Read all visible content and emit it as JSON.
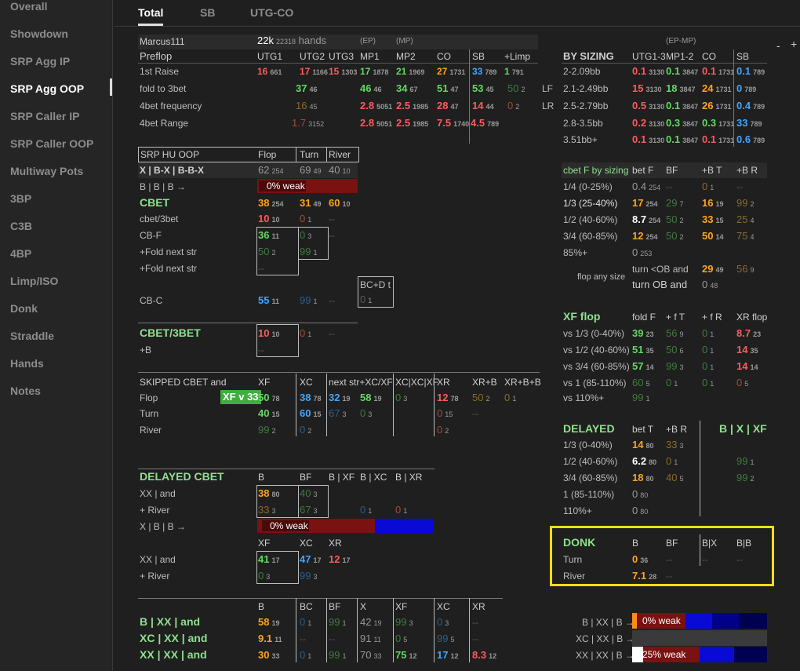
{
  "sidebar": {
    "items": [
      "Overall",
      "Showdown",
      "SRP Agg IP",
      "SRP Agg OOP",
      "SRP Caller IP",
      "SRP Caller OOP",
      "Multiway Pots",
      "3BP",
      "C3B",
      "4BP",
      "Limp/ISO",
      "Donk",
      "Straddle",
      "Hands",
      "Notes"
    ],
    "active": "SRP Agg OOP"
  },
  "tabs": [
    "Total",
    "SB",
    "UTG-CO"
  ],
  "ui": {
    "plus": "+",
    "minus": "-"
  },
  "player": {
    "name": "Marcus111",
    "hands_big": "22k",
    "hands_small": "22318",
    "hands_label": "hands",
    "ep": "(EP)",
    "mp": "(MP)"
  },
  "preflop": {
    "title": "Preflop",
    "cols": [
      "UTG1",
      "UTG2",
      "UTG3",
      "MP1",
      "MP2",
      "CO",
      "SB",
      "+Limp"
    ],
    "rows": [
      {
        "label": "1st Raise",
        "cells": [
          [
            "16",
            "661"
          ],
          [
            "17",
            "1166"
          ],
          [
            "15",
            "1303"
          ],
          [
            "17",
            "1878"
          ],
          [
            "21",
            "1969"
          ],
          [
            "27",
            "1731"
          ],
          [
            "33",
            "789"
          ],
          [
            "1",
            "791"
          ]
        ]
      },
      {
        "label": "fold to 3bet",
        "cells": [
          [
            "37",
            "46"
          ],
          [
            "46",
            "46"
          ],
          [
            "34",
            "67"
          ],
          [
            "51",
            "47"
          ],
          [
            "53",
            "45"
          ],
          [
            "50",
            "2"
          ]
        ],
        "suffix": "LF"
      },
      {
        "label": "4bet frequency",
        "cells": [
          [
            "16",
            "45"
          ],
          [
            "2.8",
            "5051"
          ],
          [
            "2.5",
            "1985"
          ],
          [
            "28",
            "47"
          ],
          [
            "14",
            "44"
          ],
          [
            "0",
            "2"
          ]
        ],
        "suffix": "LR"
      },
      {
        "label": "4bet Range",
        "cells": [
          [
            "1.7",
            "3152"
          ],
          [
            "2.8",
            "5051"
          ],
          [
            "2.5",
            "1985"
          ],
          [
            "7.5",
            "1740"
          ],
          [
            "4.5",
            "789"
          ]
        ]
      }
    ]
  },
  "bysizing": {
    "title": "BY SIZING",
    "epmp": "(EP-MP)",
    "cols": [
      "UTG1-3",
      "MP1-2",
      "CO",
      "SB"
    ],
    "rows": [
      {
        "label": "2-2.09bb",
        "cells": [
          [
            "0.1",
            "3130"
          ],
          [
            "0.1",
            "3847"
          ],
          [
            "0.1",
            "1731"
          ],
          [
            "0.1",
            "789"
          ]
        ]
      },
      {
        "label": "2.1-2.49bb",
        "cells": [
          [
            "15",
            "3130"
          ],
          [
            "18",
            "3847"
          ],
          [
            "24",
            "1731"
          ],
          [
            "0",
            "789"
          ]
        ]
      },
      {
        "label": "2.5-2.79bb",
        "cells": [
          [
            "0.5",
            "3130"
          ],
          [
            "0.1",
            "3847"
          ],
          [
            "26",
            "1731"
          ],
          [
            "0.4",
            "789"
          ]
        ]
      },
      {
        "label": "2.8-3.5bb",
        "cells": [
          [
            "0.2",
            "3130"
          ],
          [
            "0.3",
            "3847"
          ],
          [
            "0.3",
            "1731"
          ],
          [
            "33",
            "789"
          ]
        ]
      },
      {
        "label": "3.51bb+",
        "cells": [
          [
            "0.1",
            "3130"
          ],
          [
            "0.1",
            "3847"
          ],
          [
            "0.1",
            "1731"
          ],
          [
            "0.6",
            "789"
          ]
        ]
      }
    ]
  },
  "srp": {
    "title": "SRP HU OOP",
    "cols": [
      "Flop",
      "Turn",
      "River"
    ],
    "lines": [
      "X | B-X | B-B-X",
      "B | B | B →",
      "CBET",
      "cbet/3bet",
      "CB-F",
      "+Fold next str",
      "+Fold next str",
      "CB-C"
    ],
    "xbx": [
      [
        "62",
        "254"
      ],
      [
        "69",
        "49"
      ],
      [
        "40",
        "10"
      ]
    ],
    "weak": "0% weak",
    "cbet": [
      [
        "38",
        "254"
      ],
      [
        "31",
        "49"
      ],
      [
        "60",
        "10"
      ]
    ],
    "cbet3bet": [
      "10",
      "10",
      "0",
      "1",
      "--"
    ],
    "cbf": [
      "36",
      "11",
      "0",
      "3",
      "--",
      "50",
      "2",
      "99",
      "1",
      "--"
    ],
    "bcdt": "BC+D t",
    "bcdt_v": [
      "0",
      "1"
    ],
    "cbc": [
      [
        "55",
        "11"
      ],
      [
        "99",
        "1"
      ],
      "--"
    ]
  },
  "cbet3": {
    "title": "CBET/3BET",
    "b": "+B",
    "v": [
      "10",
      "10",
      "0",
      "1",
      "--",
      "--"
    ]
  },
  "skipped": {
    "title": "SKIPPED CBET and",
    "cols": [
      "XF",
      "XC",
      "next str+XC/XF",
      "XC|XC|XF",
      "XR",
      "XR+B",
      "XR+B+B"
    ],
    "badge": "XF v 33",
    "rows": [
      {
        "label": "Flop",
        "cells": [
          [
            "50",
            "78"
          ],
          [
            "38",
            "78"
          ],
          [
            "32",
            "19"
          ],
          [
            "58",
            "19"
          ],
          [
            "0",
            "3"
          ],
          [
            "12",
            "78"
          ],
          [
            "50",
            "2"
          ],
          [
            "0",
            "1"
          ]
        ]
      },
      {
        "label": "Turn",
        "cells": [
          [
            "40",
            "15"
          ],
          [
            "60",
            "15"
          ],
          [
            "67",
            "3"
          ],
          [
            "0",
            "3"
          ],
          "",
          [
            "0",
            "15"
          ],
          "--"
        ]
      },
      {
        "label": "River",
        "cells": [
          [
            "99",
            "2"
          ],
          [
            "0",
            "2"
          ],
          "",
          "",
          "",
          [
            "0",
            "2"
          ]
        ]
      }
    ]
  },
  "delayed": {
    "title": "DELAYED CBET",
    "cols": [
      "B",
      "BF",
      "B | XF",
      "B | XC",
      "B | XR"
    ],
    "rows": [
      {
        "label": "XX | and",
        "cells": [
          [
            "38",
            "80"
          ],
          [
            "40",
            "3"
          ],
          "",
          "",
          ""
        ]
      },
      {
        "label": "+ River",
        "cells": [
          [
            "33",
            "3"
          ],
          [
            "67",
            "3"
          ],
          [
            "0",
            "1"
          ],
          [
            "0",
            "1"
          ],
          ""
        ]
      }
    ],
    "xbb": "X | B | B →",
    "weak": "0% weak",
    "cols2": [
      "XF",
      "XC",
      "XR"
    ],
    "rows2": [
      {
        "label": "XX | and",
        "cells": [
          [
            "41",
            "17"
          ],
          [
            "47",
            "17"
          ],
          [
            "12",
            "17"
          ]
        ]
      },
      {
        "label": "+ River",
        "cells": [
          [
            "0",
            "3"
          ],
          [
            "99",
            "3"
          ]
        ]
      }
    ]
  },
  "bxx": {
    "cols": [
      "B",
      "BC",
      "BF",
      "X",
      "XF",
      "XC",
      "XR"
    ],
    "rows": [
      {
        "label": "B | XX | and",
        "cells": [
          [
            "58",
            "19"
          ],
          [
            "0",
            "1"
          ],
          [
            "99",
            "1"
          ],
          [
            "42",
            "19"
          ],
          [
            "99",
            "3"
          ],
          [
            "0",
            "3"
          ],
          "--"
        ]
      },
      {
        "label": "XC | XX | and",
        "cells": [
          [
            "9.1",
            "11"
          ],
          "--",
          "--",
          [
            "91",
            "11"
          ],
          [
            "0",
            "5"
          ],
          [
            "99",
            "5"
          ],
          "--"
        ]
      },
      {
        "label": "XX | XX | and",
        "cells": [
          [
            "30",
            "33"
          ],
          [
            "0",
            "1"
          ],
          [
            "99",
            "1"
          ],
          [
            "70",
            "33"
          ],
          [
            "75",
            "12"
          ],
          [
            "17",
            "12"
          ],
          [
            "8.3",
            "12"
          ]
        ]
      }
    ]
  },
  "cbetsize": {
    "title": "cbet F by sizing",
    "cols": [
      "bet F",
      "BF",
      "+B T",
      "+B R"
    ],
    "rows": [
      {
        "label": "1/4 (0-25%)",
        "cells": [
          [
            "0.4",
            "254"
          ],
          "--",
          [
            "0",
            "1"
          ],
          "--"
        ]
      },
      {
        "label": "1/3 (25-40%)",
        "cells": [
          [
            "17",
            "254"
          ],
          [
            "29",
            "7"
          ],
          [
            "16",
            "19"
          ],
          [
            "99",
            "2"
          ]
        ]
      },
      {
        "label": "1/2 (40-60%)",
        "cells": [
          [
            "8.7",
            "254"
          ],
          [
            "50",
            "2"
          ],
          [
            "33",
            "15"
          ],
          [
            "25",
            "4"
          ]
        ]
      },
      {
        "label": "3/4 (60-85%)",
        "cells": [
          [
            "12",
            "254"
          ],
          [
            "50",
            "2"
          ],
          [
            "50",
            "14"
          ],
          [
            "75",
            "4"
          ]
        ]
      },
      {
        "label": "85%+",
        "cells": [
          [
            "0",
            "253"
          ]
        ]
      }
    ],
    "flopany": "flop any size",
    "turnlt": "turn <OB and",
    "turnob": "turn OB and",
    "turnlt_v": [
      [
        "29",
        "49"
      ],
      [
        "56",
        "9"
      ]
    ],
    "turnob_v": [
      [
        "0",
        "48"
      ]
    ]
  },
  "xfflop": {
    "title": "XF flop",
    "cols": [
      "fold F",
      "+ f T",
      "+ f R",
      "XR flop"
    ],
    "rows": [
      {
        "label": "vs 1/3 (0-40%)",
        "cells": [
          [
            "39",
            "23"
          ],
          [
            "56",
            "9"
          ],
          [
            "0",
            "1"
          ],
          [
            "8.7",
            "23"
          ]
        ]
      },
      {
        "label": "vs 1/2 (40-60%)",
        "cells": [
          [
            "51",
            "35"
          ],
          [
            "50",
            "6"
          ],
          [
            "0",
            "1"
          ],
          [
            "14",
            "35"
          ]
        ]
      },
      {
        "label": "vs 3/4 (60-85%)",
        "cells": [
          [
            "57",
            "14"
          ],
          [
            "99",
            "3"
          ],
          [
            "0",
            "1"
          ],
          [
            "14",
            "14"
          ]
        ]
      },
      {
        "label": "vs 1 (85-110%)",
        "cells": [
          [
            "60",
            "5"
          ],
          [
            "0",
            "1"
          ],
          [
            "0",
            "1"
          ],
          [
            "0",
            "5"
          ]
        ]
      },
      {
        "label": "vs 110%+",
        "cells": [
          [
            "99",
            "1"
          ]
        ]
      }
    ]
  },
  "delayed2": {
    "title": "DELAYED",
    "cols": [
      "bet T",
      "+B R"
    ],
    "bxxf": "B | X | XF",
    "rows": [
      {
        "label": "1/3 (0-40%)",
        "cells": [
          [
            "14",
            "80"
          ],
          [
            "33",
            "3"
          ]
        ],
        "right": ""
      },
      {
        "label": "1/2 (40-60%)",
        "cells": [
          [
            "6.2",
            "80"
          ],
          [
            "0",
            "1"
          ]
        ],
        "right": [
          "99",
          "1"
        ]
      },
      {
        "label": "3/4 (60-85%)",
        "cells": [
          [
            "18",
            "80"
          ],
          [
            "40",
            "5"
          ]
        ],
        "right": [
          "99",
          "2"
        ]
      },
      {
        "label": "1 (85-110%)",
        "cells": [
          [
            "0",
            "80"
          ]
        ],
        "right": ""
      },
      {
        "label": "110%+",
        "cells": [
          [
            "0",
            "80"
          ]
        ],
        "right": ""
      }
    ]
  },
  "donk": {
    "title": "DONK",
    "cols": [
      "B",
      "BF",
      "B|X",
      "B|B"
    ],
    "rows": [
      {
        "label": "Turn",
        "cells": [
          [
            "0",
            "36"
          ],
          "--",
          "--",
          "--"
        ]
      },
      {
        "label": "River",
        "cells": [
          [
            "7.1",
            "28"
          ],
          "--"
        ]
      }
    ]
  },
  "bottombars": [
    {
      "label": "B | XX | B →",
      "text": "0% weak"
    },
    {
      "label": "XC | XX | B →",
      "text": ""
    },
    {
      "label": "XX | XX | B →",
      "text": "25% weak"
    }
  ]
}
